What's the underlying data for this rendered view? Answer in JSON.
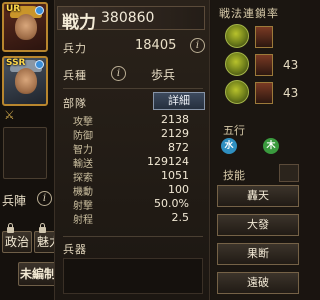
{
  "portraits": [
    {
      "rarity": "UR"
    },
    {
      "rarity": "SSR"
    }
  ],
  "bottom_left": {
    "formation_label": "兵陣",
    "politics_btn": "政治",
    "charisma_btn": "魅力",
    "unassigned_btn": "未編制"
  },
  "center": {
    "power_label": "戦力",
    "power_value": "380860",
    "troops_label": "兵力",
    "troops_value": "18405",
    "troop_type_label": "兵種",
    "troop_type_value": "歩兵",
    "unit_label": "部隊",
    "detail_button": "詳細",
    "stats": [
      {
        "name": "攻撃",
        "value": "2138"
      },
      {
        "name": "防御",
        "value": "2129"
      },
      {
        "name": "智力",
        "value": "872"
      },
      {
        "name": "輸送",
        "value": "129124"
      },
      {
        "name": "探索",
        "value": "1051"
      },
      {
        "name": "機動",
        "value": "100"
      },
      {
        "name": "射撃",
        "value": "50.0%"
      },
      {
        "name": "射程",
        "value": "2.5"
      }
    ],
    "weapon_label": "兵器"
  },
  "right": {
    "chain_title": "戦法連鎖率",
    "chain_values": [
      "43",
      "43"
    ],
    "five_elements_label": "五行",
    "skills_label": "技能",
    "skills": [
      "轟天",
      "大發",
      "果断",
      "遠破"
    ]
  },
  "colors": {
    "accent_gold": "#b8862e",
    "panel_bg": "#2a221a",
    "detail_blue": "#3d4a5e"
  }
}
